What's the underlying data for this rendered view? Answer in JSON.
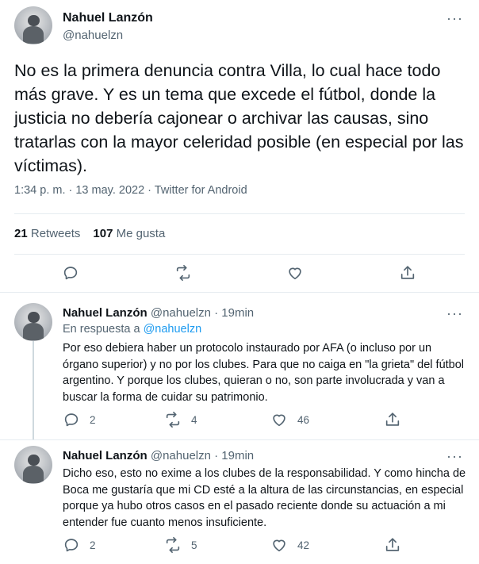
{
  "main_tweet": {
    "author_name": "Nahuel Lanzón",
    "author_handle": "@nahuelzn",
    "more_label": "···",
    "text": "No es la primera denuncia contra Villa, lo cual hace todo más grave. Y es un tema que excede el fútbol, donde la justicia no debería cajonear o archivar las causas, sino tratarlas con la mayor celeridad posible (en especial por las víctimas).",
    "meta": "1:34 p. m. · 13 may. 2022 · Twitter for Android",
    "retweets_count": "21",
    "retweets_label": "Retweets",
    "likes_count": "107",
    "likes_label": "Me gusta"
  },
  "replies": [
    {
      "author_name": "Nahuel Lanzón",
      "author_meta": "@nahuelzn · 19min",
      "in_reply_prefix": "En respuesta a",
      "in_reply_mention": "@nahuelzn",
      "text": "Por eso debiera haber un protocolo instaurado por AFA (o incluso por un órgano superior) y no por los clubes. Para que no caiga en \"la grieta\" del fútbol argentino. Y porque los clubes, quieran o no, son parte involucrada y van a buscar la forma de cuidar su patrimonio.",
      "reply_count": "2",
      "retweet_count": "4",
      "like_count": "46"
    },
    {
      "author_name": "Nahuel Lanzón",
      "author_meta": "@nahuelzn · 19min",
      "text": "Dicho eso, esto no exime a los clubes de la responsabilidad. Y como hincha de Boca me gustaría que mi CD esté a la altura de las circunstancias, en especial porque ya hubo otros casos en el pasado reciente donde su actuación a mi entender fue cuanto menos insuficiente.",
      "reply_count": "2",
      "retweet_count": "5",
      "like_count": "42"
    }
  ],
  "colors": {
    "text": "#0f1419",
    "secondary": "#536471",
    "link": "#1d9bf0",
    "divider": "#e6ecf0"
  },
  "icons": [
    "reply-icon",
    "retweet-icon",
    "like-icon",
    "share-icon",
    "more-icon"
  ]
}
